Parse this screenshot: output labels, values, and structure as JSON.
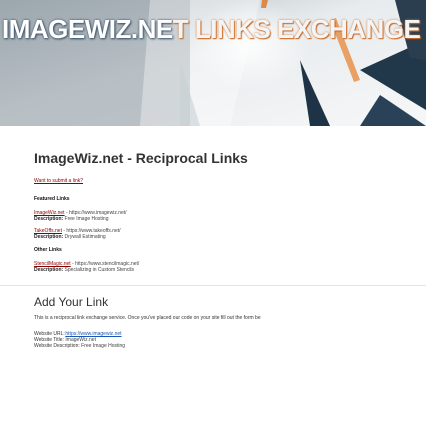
{
  "banner": {
    "title_main": "IMAGEWIZ.NE",
    "title_accent": "T LINKS EXCHANGE"
  },
  "page": {
    "title": "ImageWiz.net - Reciprocal Links",
    "submit_link": "Want to submit a link?"
  },
  "featured": {
    "heading": "Featured Links",
    "items": [
      {
        "site": "ImageWiz.net",
        "url": " - https://www.imagewiz.net/",
        "desc_label": "Description:",
        "desc": " Free Image Hosting"
      },
      {
        "site": "TakeOffs.net",
        "url": " - https://www.takeoffs.net/",
        "desc_label": "Description:",
        "desc": " Drywall Estimating"
      }
    ]
  },
  "other": {
    "heading": "Other Links",
    "items": [
      {
        "site": "StencilMagic.net",
        "url": " - https://www.stencilmagic.net/",
        "desc_label": "Description:",
        "desc": " Specializing in Custom Stencils"
      }
    ]
  },
  "add_link": {
    "title": "Add Your Link",
    "intro": "This is a reciprocal link exchange service. Once you've placed our code on your site fill out the form be",
    "fields": [
      {
        "label": "Website URL:",
        "value": "https://www.imagewiz.net",
        "is_link": true
      },
      {
        "label": "Website Title:",
        "value": "ImageWiz.net",
        "is_link": false
      },
      {
        "label": "Website Description:",
        "value": "Free Image Hosting",
        "is_link": false
      }
    ]
  }
}
